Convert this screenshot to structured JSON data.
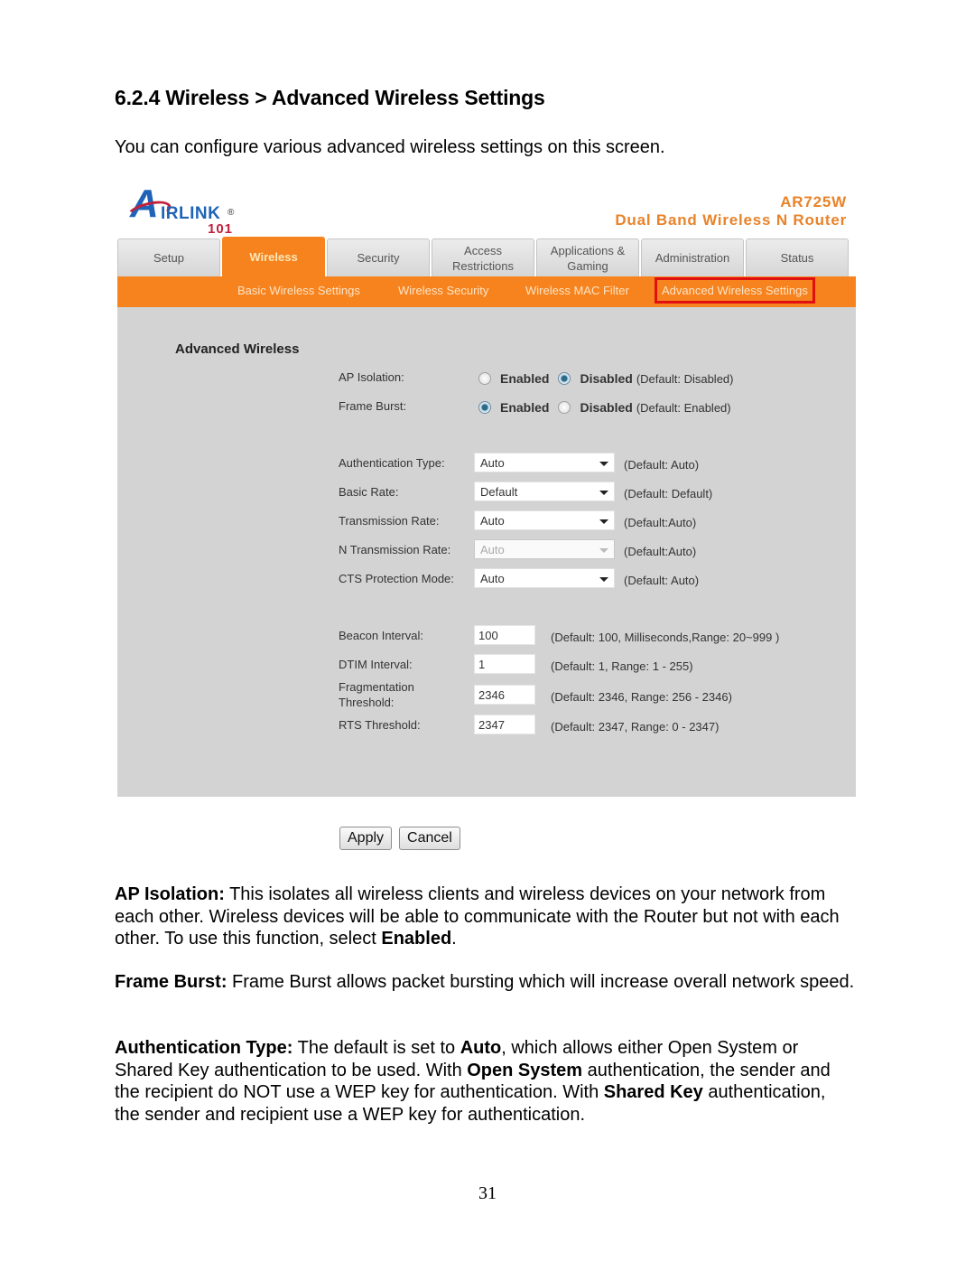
{
  "document": {
    "heading": "6.2.4 Wireless > Advanced Wireless Settings",
    "intro": "You can configure various advanced wireless settings on this screen.",
    "page_number": "31"
  },
  "router_ui": {
    "logo": {
      "letter": "A",
      "text": "IRLINK",
      "registered": "®",
      "suffix": "101"
    },
    "model": "AR725W",
    "product_name": "Dual Band Wireless N Router",
    "brand_color": "#f6831e",
    "tabs": [
      {
        "label": "Setup",
        "active": false
      },
      {
        "label": "Wireless",
        "active": true
      },
      {
        "label": "Security",
        "active": false
      },
      {
        "label": "Access Restrictions",
        "active": false
      },
      {
        "label": "Applications & Gaming",
        "active": false
      },
      {
        "label": "Administration",
        "active": false
      },
      {
        "label": "Status",
        "active": false
      }
    ],
    "subnav": [
      {
        "label": "Basic Wireless Settings",
        "active": false
      },
      {
        "label": "Wireless Security",
        "active": false
      },
      {
        "label": "Wireless MAC Filter",
        "active": false
      },
      {
        "label": "Advanced Wireless Settings",
        "active": true
      }
    ],
    "section_title": "Advanced Wireless",
    "radios": {
      "ap_isolation": {
        "label": "AP Isolation:",
        "enabled_label": "Enabled",
        "disabled_label": "Disabled",
        "selected": "Disabled",
        "default": "(Default: Disabled)"
      },
      "frame_burst": {
        "label": "Frame Burst:",
        "enabled_label": "Enabled",
        "disabled_label": "Disabled",
        "selected": "Enabled",
        "default": "(Default: Enabled)"
      }
    },
    "selects": {
      "auth_type": {
        "label": "Authentication Type:",
        "value": "Auto",
        "default": "(Default: Auto)",
        "disabled": false
      },
      "basic_rate": {
        "label": "Basic Rate:",
        "value": "Default",
        "default": "(Default: Default)",
        "disabled": false
      },
      "tx_rate": {
        "label": "Transmission Rate:",
        "value": "Auto",
        "default": "(Default:Auto)",
        "disabled": false
      },
      "n_tx_rate": {
        "label": "N Transmission Rate:",
        "value": "Auto",
        "default": "(Default:Auto)",
        "disabled": true
      },
      "cts_mode": {
        "label": "CTS Protection Mode:",
        "value": "Auto",
        "default": "(Default: Auto)",
        "disabled": false
      }
    },
    "inputs": {
      "beacon": {
        "label": "Beacon Interval:",
        "value": "100",
        "hint": "(Default: 100, Milliseconds,Range: 20~999 )"
      },
      "dtim": {
        "label": "DTIM Interval:",
        "value": "1",
        "hint": "(Default: 1, Range: 1 - 255)"
      },
      "frag": {
        "label_line1": "Fragmentation",
        "label_line2": "Threshold:",
        "value": "2346",
        "hint": "(Default: 2346, Range: 256 - 2346)"
      },
      "rts": {
        "label": "RTS Threshold:",
        "value": "2347",
        "hint": "(Default: 2347, Range: 0 - 2347)"
      }
    },
    "buttons": {
      "apply": "Apply",
      "cancel": "Cancel"
    }
  },
  "descriptions": {
    "ap_isolation": {
      "term": "AP Isolation:",
      "text1": " This isolates all wireless clients and wireless devices on your network from each other. Wireless devices will be able to communicate with the Router but not with each other. To use this function, select ",
      "bold1": "Enabled",
      "text2": "."
    },
    "frame_burst": {
      "term": "Frame Burst:",
      "text1": " Frame Burst allows packet bursting which will increase overall network speed."
    },
    "auth_type": {
      "term": "Authentication Type:",
      "text1": " The default is set to ",
      "bold1": "Auto",
      "text2": ", which allows either Open System or Shared Key authentication to be used. With ",
      "bold2": "Open System",
      "text3": " authentication, the sender and the recipient do NOT use a WEP key for authentication. With ",
      "bold3": "Shared Key",
      "text4": " authentication, the sender and recipient use a WEP key for authentication."
    }
  }
}
